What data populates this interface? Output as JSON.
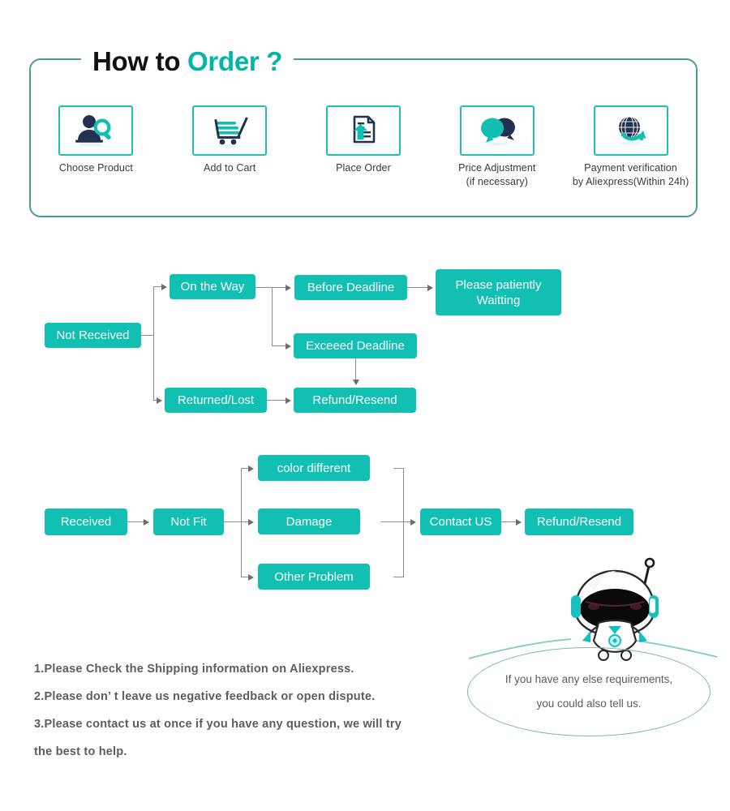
{
  "header": {
    "title_plain": "How to ",
    "title_accent": "Order ?",
    "accent_color": "#00b6a6",
    "border_color": "#4f9a98"
  },
  "steps": [
    {
      "icon": "person-search-icon",
      "label": "Choose  Product",
      "label2": ""
    },
    {
      "icon": "shopping-cart-icon",
      "label": "Add to Cart",
      "label2": ""
    },
    {
      "icon": "upload-document-icon",
      "label": "Place  Order",
      "label2": ""
    },
    {
      "icon": "chat-bubbles-icon",
      "label": "Price Adjustment",
      "label2": "(if necessary)"
    },
    {
      "icon": "globe-arrow-icon",
      "label": "Payment verification",
      "label2": "by Aliexpress(Within 24h)"
    }
  ],
  "flow_not_received": {
    "nodes": {
      "not_received": "Not Received",
      "on_the_way": "On the Way",
      "before_deadline": "Before Deadline",
      "please_wait": "Please patiently Waitting",
      "exceed_deadline": "Exceeed Deadline",
      "returned_lost": "Returned/Lost",
      "refund_resend": "Refund/Resend"
    }
  },
  "flow_received": {
    "nodes": {
      "received": "Received",
      "not_fit": "Not Fit",
      "color_different": "color different",
      "damage": "Damage",
      "other_problem": "Other Problem",
      "contact_us": "Contact US",
      "refund_resend": "Refund/Resend"
    }
  },
  "notes": [
    "1.Please Check the Shipping information on Aliexpress.",
    "2.Please don’ t leave us negative feedback or open dispute.",
    "3.Please contact us at once if you have any question, we will try",
    " the best to help."
  ],
  "bubble": {
    "line1": "If you have any else requirements,",
    "line2": "you could also tell us."
  },
  "colors": {
    "node_teal": "#11c0b2",
    "icon_border": "#1fbfb4",
    "navy": "#22314f",
    "note_gray": "#5d5d5d"
  }
}
